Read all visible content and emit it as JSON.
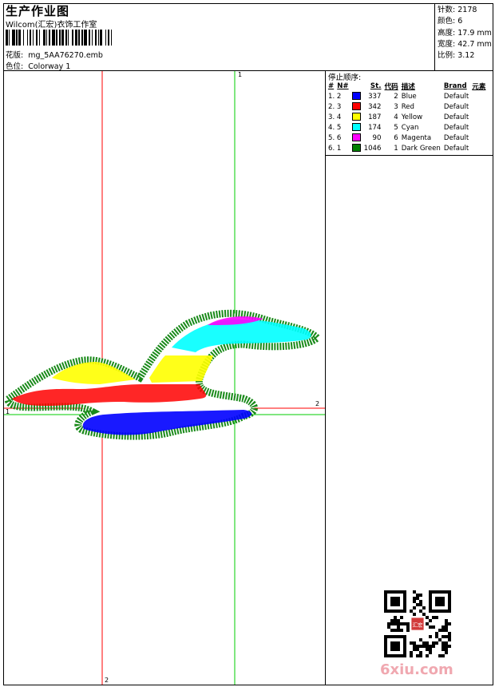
{
  "header": {
    "title": "生产作业图",
    "company": "Wilcom(汇宏)衣饰工作室",
    "design_label": "花版:",
    "design_file": "mg_5AA76270.emb",
    "colorway_label": "色位:",
    "colorway": "Colorway 1"
  },
  "stats": [
    {
      "label": "针数:",
      "value": "2178"
    },
    {
      "label": "颜色:",
      "value": "6"
    },
    {
      "label": "高度:",
      "value": "17.9 mm"
    },
    {
      "label": "宽度:",
      "value": "42.7 mm"
    },
    {
      "label": "比例:",
      "value": "3.12"
    }
  ],
  "stop_sequence": {
    "title": "停止顺序:",
    "headers": [
      "#",
      "N#",
      "",
      "St.",
      "代码",
      "描述",
      "Brand",
      "元素"
    ],
    "rows": [
      {
        "idx": "1. 2",
        "color": "#0000ff",
        "stitches": "337",
        "code": "2",
        "desc": "Blue",
        "brand": "Default"
      },
      {
        "idx": "2. 3",
        "color": "#ff0000",
        "stitches": "342",
        "code": "3",
        "desc": "Red",
        "brand": "Default"
      },
      {
        "idx": "3. 4",
        "color": "#ffff00",
        "stitches": "187",
        "code": "4",
        "desc": "Yellow",
        "brand": "Default"
      },
      {
        "idx": "4. 5",
        "color": "#00ffff",
        "stitches": "174",
        "code": "5",
        "desc": "Cyan",
        "brand": "Default"
      },
      {
        "idx": "5. 6",
        "color": "#ff00ff",
        "stitches": "90",
        "code": "6",
        "desc": "Magenta",
        "brand": "Default"
      },
      {
        "idx": "6. 1",
        "color": "#008000",
        "stitches": "1046",
        "code": "1",
        "desc": "Dark Green",
        "brand": "Default"
      }
    ]
  },
  "guides": {
    "green_v_label": "1",
    "green_h_label": "1",
    "red_h_label": "2",
    "red_v_label": "2"
  },
  "watermark": "6xiu.com",
  "qr_stamp_text": "汇宏",
  "colors": {
    "green_guide": "#00cc00",
    "red_guide": "#ff0000",
    "outline": "#1a8a1a"
  }
}
